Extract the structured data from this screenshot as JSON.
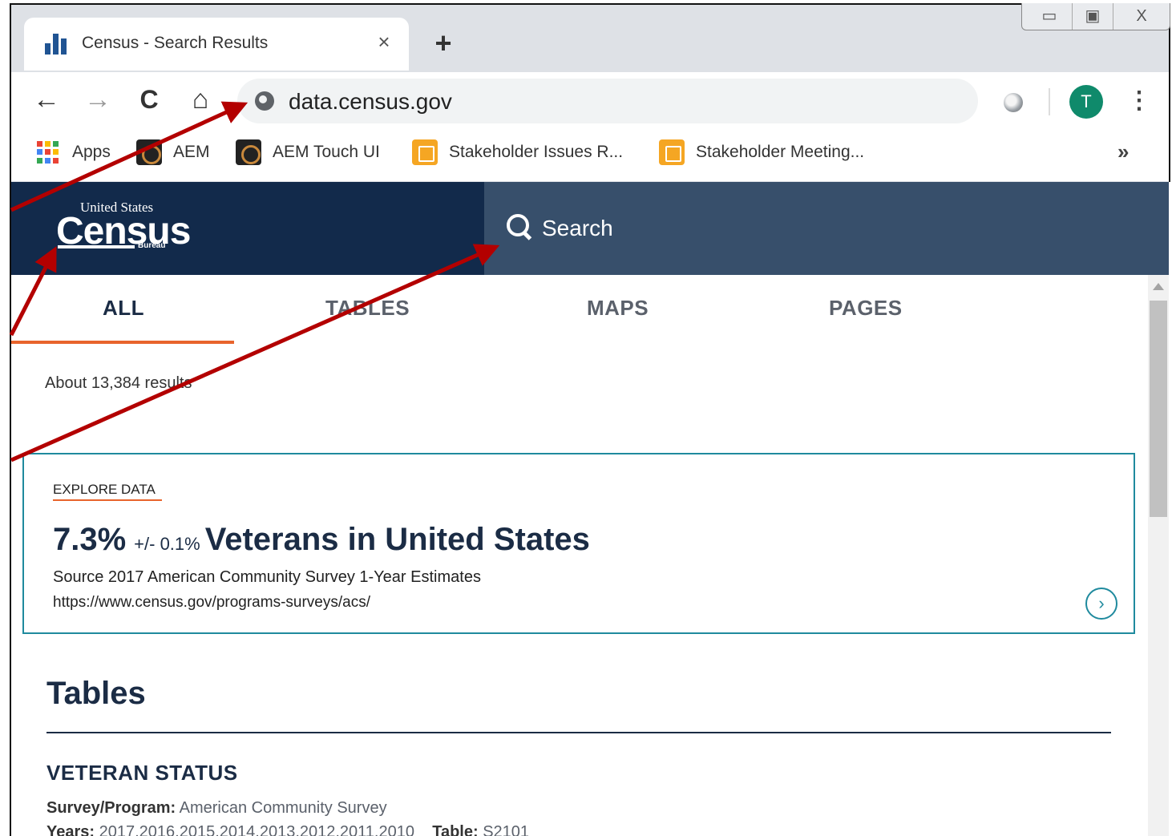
{
  "browser": {
    "tab_title": "Census - Search Results",
    "tab_close": "×",
    "new_tab": "+",
    "window_controls": {
      "minimize": "▭",
      "maximize": "▣",
      "close": "X"
    },
    "nav": {
      "back": "←",
      "forward": "→",
      "reload": "C",
      "home": "⌂"
    },
    "url": "data.census.gov",
    "avatar_initial": "T",
    "menu": "⋮",
    "bookmarks": [
      {
        "label": "Apps",
        "icon": "apps-grid-icon"
      },
      {
        "label": "AEM",
        "icon": "aem-icon"
      },
      {
        "label": "AEM Touch UI",
        "icon": "aem-icon"
      },
      {
        "label": "Stakeholder Issues R...",
        "icon": "stakeholder-icon"
      },
      {
        "label": "Stakeholder Meeting...",
        "icon": "stakeholder-icon"
      }
    ],
    "bookmarks_more": "»"
  },
  "header": {
    "logo": {
      "top": "United States",
      "main": "Census",
      "bottom": "Bureau"
    },
    "search_label": "Search"
  },
  "results": {
    "tabs": [
      "ALL",
      "TABLES",
      "MAPS",
      "PAGES"
    ],
    "active_tab": "ALL",
    "count_text": "About 13,384 results"
  },
  "explore_card": {
    "eyebrow": "EXPLORE DATA",
    "value": "7.3%",
    "moe": "+/- 0.1%",
    "subject": "Veterans in United States",
    "source": "Source 2017 American Community Survey 1-Year Estimates",
    "url": "https://www.census.gov/programs-surveys/acs/",
    "arrow": "›"
  },
  "tables_section": {
    "title": "Tables",
    "item": {
      "title": "VETERAN STATUS",
      "survey_label": "Survey/Program:",
      "survey_value": "American Community Survey",
      "years_label": "Years:",
      "years_value": "2017,2016,2015,2014,2013,2012,2011,2010",
      "table_label": "Table:",
      "table_value": "S2101"
    }
  },
  "colors": {
    "header_dark": "#122a4b",
    "search_bar": "#374f6b",
    "accent_orange": "#e8642c",
    "card_border": "#1f8a9e",
    "annotation_arrow": "#b30000"
  }
}
